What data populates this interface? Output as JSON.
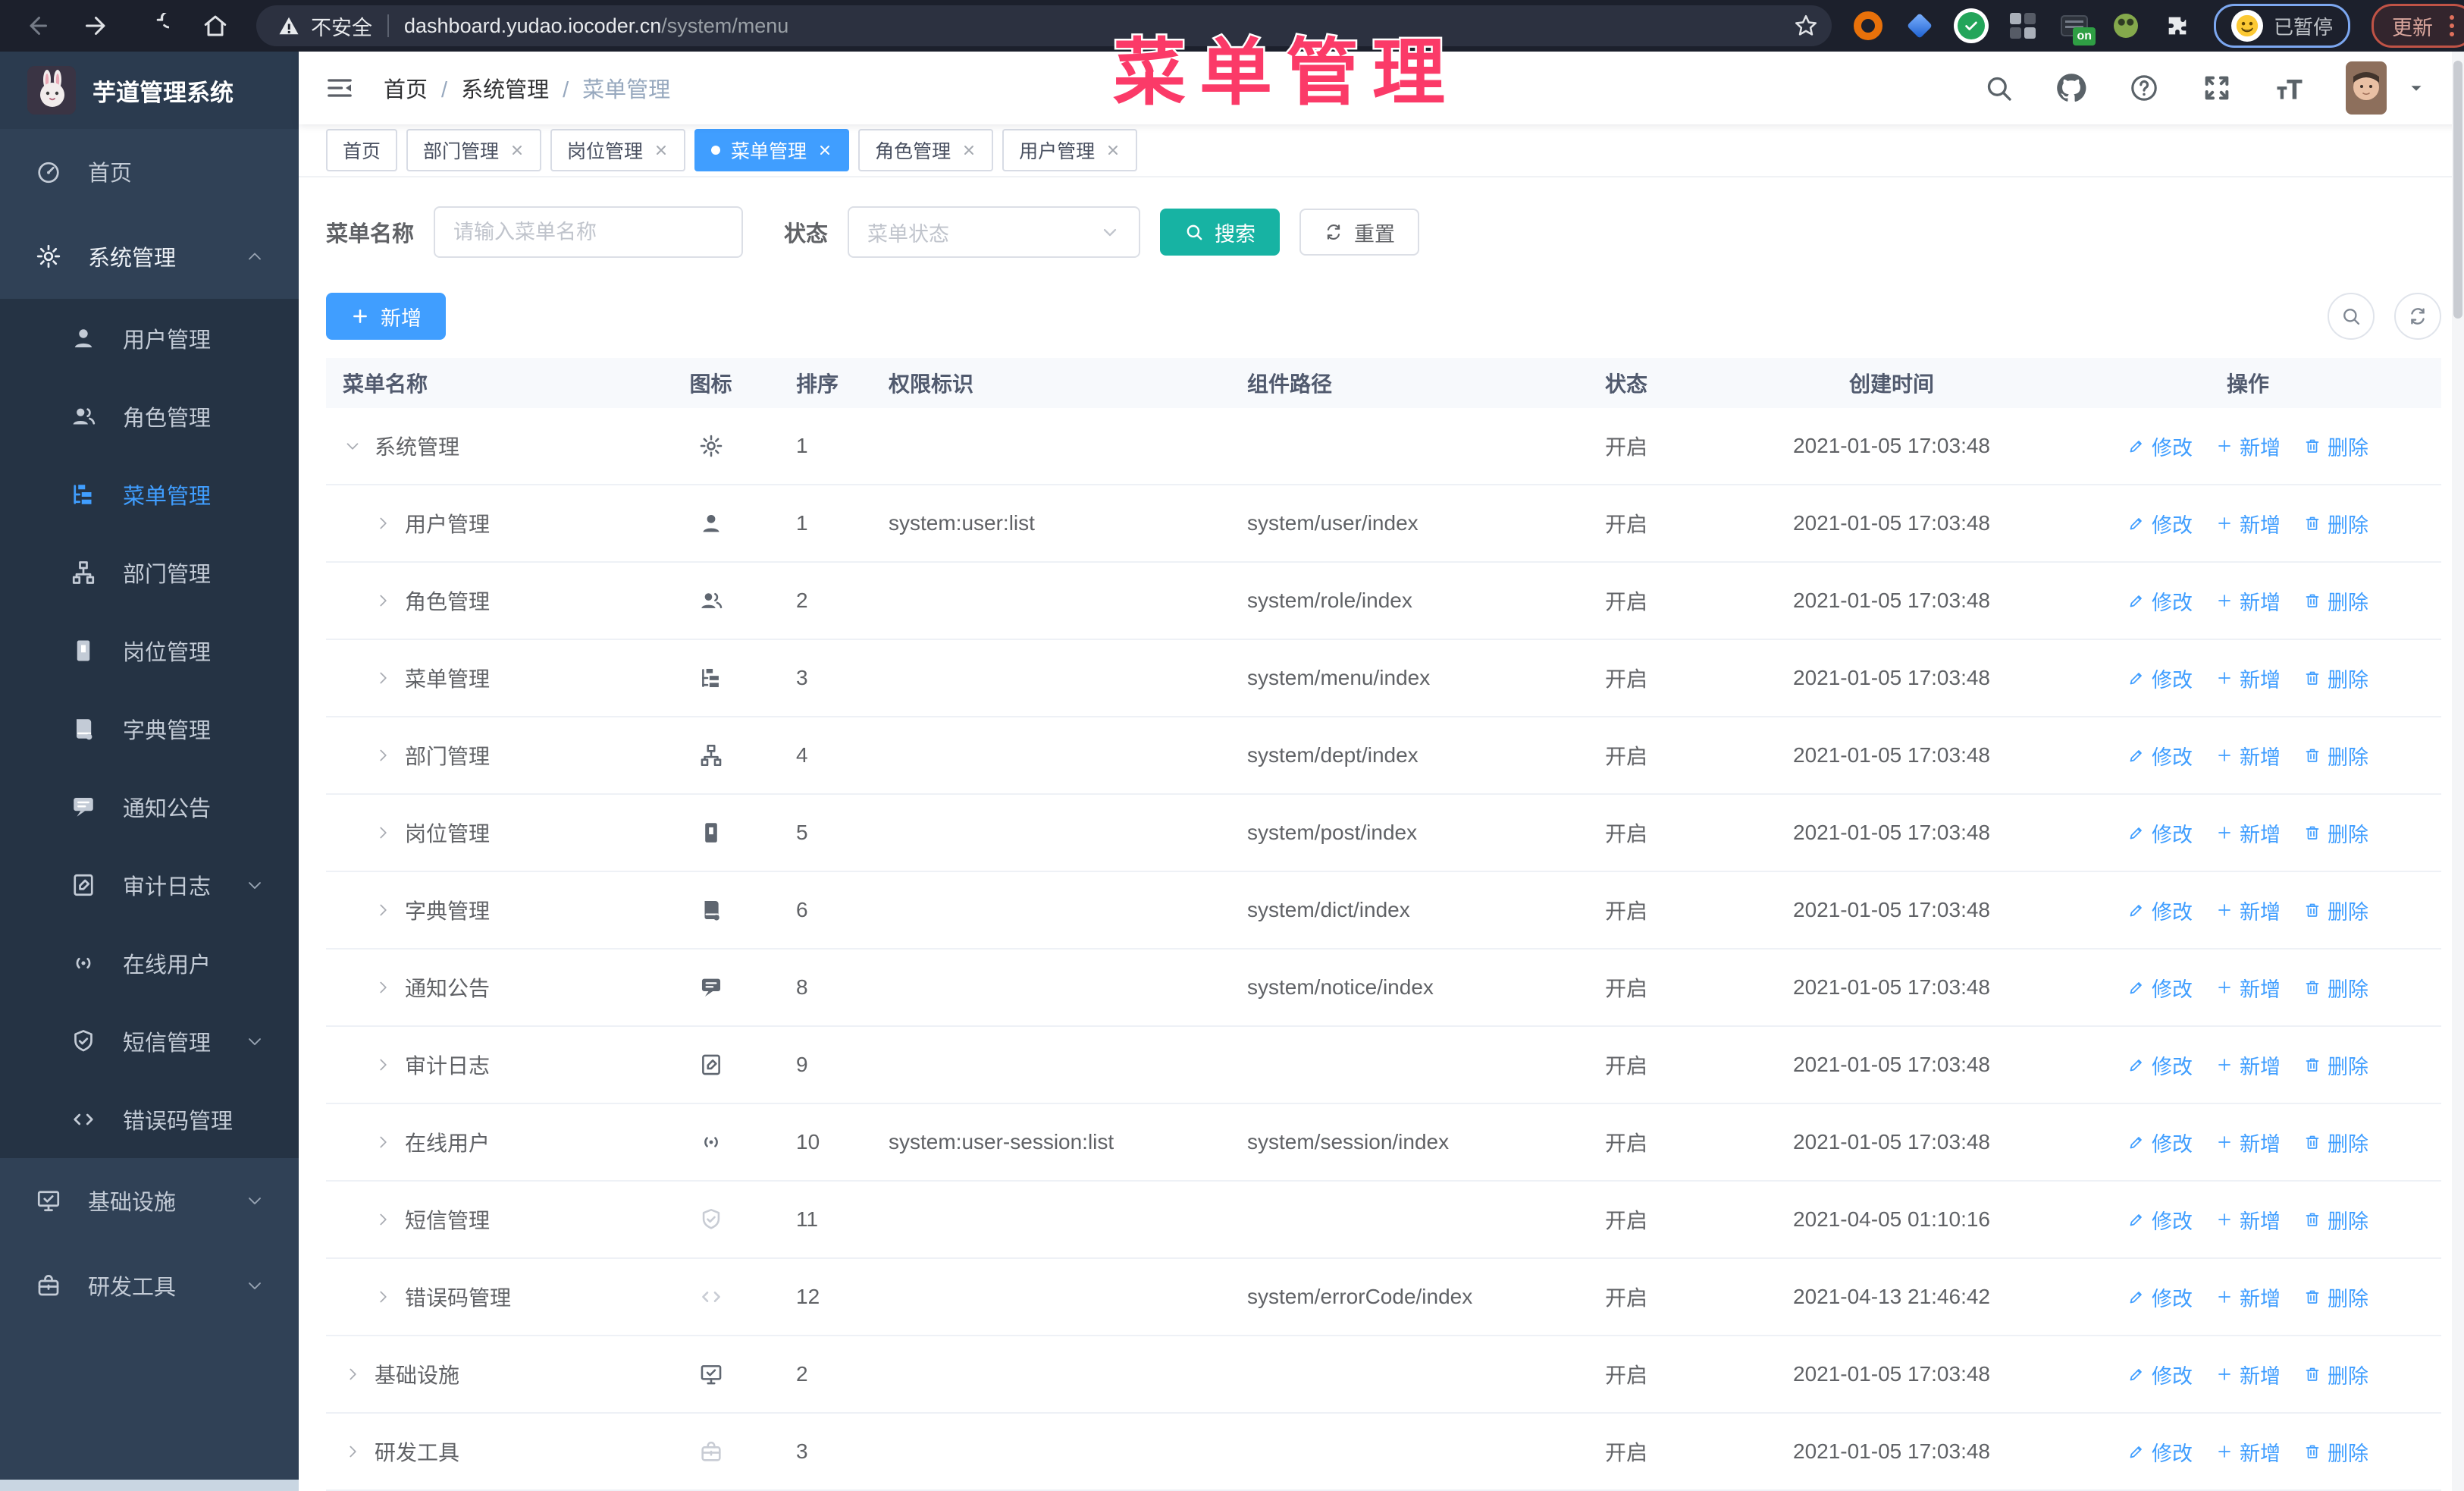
{
  "browser": {
    "security_label": "不安全",
    "host": "dashboard.yudao.iocoder.cn",
    "path": "/system/menu",
    "profile_label": "已暂停",
    "update_label": "更新"
  },
  "watermark": "菜单管理",
  "sidebar": {
    "logo_title": "芋道管理系统",
    "items": [
      {
        "label": "首页",
        "icon": "dashboard"
      },
      {
        "label": "系统管理",
        "icon": "gear",
        "arrow": "up",
        "open": true,
        "children": [
          {
            "label": "用户管理",
            "icon": "user"
          },
          {
            "label": "角色管理",
            "icon": "users"
          },
          {
            "label": "菜单管理",
            "icon": "tree-table",
            "active": true
          },
          {
            "label": "部门管理",
            "icon": "tree"
          },
          {
            "label": "岗位管理",
            "icon": "post"
          },
          {
            "label": "字典管理",
            "icon": "dict"
          },
          {
            "label": "通知公告",
            "icon": "message"
          },
          {
            "label": "审计日志",
            "icon": "log",
            "arrow": "down"
          },
          {
            "label": "在线用户",
            "icon": "online"
          },
          {
            "label": "短信管理",
            "icon": "sms",
            "arrow": "down"
          },
          {
            "label": "错误码管理",
            "icon": "code"
          }
        ]
      },
      {
        "label": "基础设施",
        "icon": "monitor",
        "arrow": "down"
      },
      {
        "label": "研发工具",
        "icon": "tool",
        "arrow": "down"
      }
    ]
  },
  "header": {
    "breadcrumb": [
      "首页",
      "系统管理",
      "菜单管理"
    ]
  },
  "tabs": [
    {
      "label": "首页"
    },
    {
      "label": "部门管理",
      "closable": true
    },
    {
      "label": "岗位管理",
      "closable": true
    },
    {
      "label": "菜单管理",
      "closable": true,
      "active": true
    },
    {
      "label": "角色管理",
      "closable": true
    },
    {
      "label": "用户管理",
      "closable": true
    }
  ],
  "filters": {
    "name_label": "菜单名称",
    "name_placeholder": "请输入菜单名称",
    "status_label": "状态",
    "status_placeholder": "菜单状态",
    "search_label": "搜索",
    "reset_label": "重置"
  },
  "toolbar": {
    "add_label": "新增"
  },
  "table": {
    "columns": [
      "菜单名称",
      "图标",
      "排序",
      "权限标识",
      "组件路径",
      "状态",
      "创建时间",
      "操作"
    ],
    "actions": {
      "edit": "修改",
      "add": "新增",
      "delete": "删除"
    },
    "rows": [
      {
        "name": "系统管理",
        "icon": "gear",
        "level": 0,
        "expanded": true,
        "sort": "1",
        "perm": "",
        "path": "",
        "status": "开启",
        "created": "2021-01-05 17:03:48"
      },
      {
        "name": "用户管理",
        "icon": "user",
        "level": 1,
        "sort": "1",
        "perm": "system:user:list",
        "path": "system/user/index",
        "status": "开启",
        "created": "2021-01-05 17:03:48"
      },
      {
        "name": "角色管理",
        "icon": "users",
        "level": 1,
        "sort": "2",
        "perm": "",
        "path": "system/role/index",
        "status": "开启",
        "created": "2021-01-05 17:03:48"
      },
      {
        "name": "菜单管理",
        "icon": "tree-table",
        "level": 1,
        "sort": "3",
        "perm": "",
        "path": "system/menu/index",
        "status": "开启",
        "created": "2021-01-05 17:03:48"
      },
      {
        "name": "部门管理",
        "icon": "tree",
        "level": 1,
        "sort": "4",
        "perm": "",
        "path": "system/dept/index",
        "status": "开启",
        "created": "2021-01-05 17:03:48"
      },
      {
        "name": "岗位管理",
        "icon": "post",
        "level": 1,
        "sort": "5",
        "perm": "",
        "path": "system/post/index",
        "status": "开启",
        "created": "2021-01-05 17:03:48"
      },
      {
        "name": "字典管理",
        "icon": "dict",
        "level": 1,
        "sort": "6",
        "perm": "",
        "path": "system/dict/index",
        "status": "开启",
        "created": "2021-01-05 17:03:48"
      },
      {
        "name": "通知公告",
        "icon": "message",
        "level": 1,
        "sort": "8",
        "perm": "",
        "path": "system/notice/index",
        "status": "开启",
        "created": "2021-01-05 17:03:48"
      },
      {
        "name": "审计日志",
        "icon": "log",
        "level": 1,
        "sort": "9",
        "perm": "",
        "path": "",
        "status": "开启",
        "created": "2021-01-05 17:03:48"
      },
      {
        "name": "在线用户",
        "icon": "online",
        "level": 1,
        "sort": "10",
        "perm": "system:user-session:list",
        "path": "system/session/index",
        "status": "开启",
        "created": "2021-01-05 17:03:48"
      },
      {
        "name": "短信管理",
        "icon": "sms",
        "light": true,
        "level": 1,
        "sort": "11",
        "perm": "",
        "path": "",
        "status": "开启",
        "created": "2021-04-05 01:10:16"
      },
      {
        "name": "错误码管理",
        "icon": "code",
        "light": true,
        "level": 1,
        "sort": "12",
        "perm": "",
        "path": "system/errorCode/index",
        "status": "开启",
        "created": "2021-04-13 21:46:42"
      },
      {
        "name": "基础设施",
        "icon": "monitor",
        "level": 0,
        "sort": "2",
        "perm": "",
        "path": "",
        "status": "开启",
        "created": "2021-01-05 17:03:48"
      },
      {
        "name": "研发工具",
        "icon": "tool",
        "light": true,
        "level": 0,
        "sort": "3",
        "perm": "",
        "path": "",
        "status": "开启",
        "created": "2021-01-05 17:03:48"
      }
    ]
  }
}
